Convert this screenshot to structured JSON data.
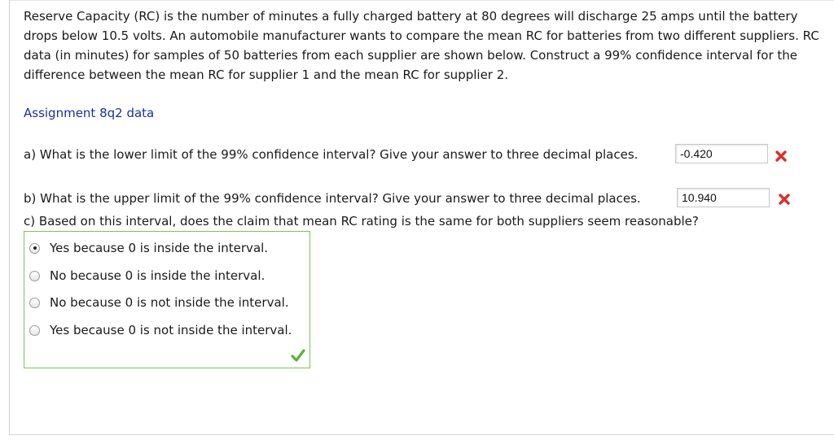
{
  "question": {
    "intro": "Reserve Capacity (RC) is the number of minutes a fully charged battery at 80 degrees will discharge 25 amps until the battery drops below 10.5 volts. An automobile manufacturer wants to compare the mean RC for batteries from two different suppliers. RC data (in minutes) for samples of 50 batteries from each supplier are shown below. Construct a 99% confidence interval for the difference between the mean RC for supplier 1 and the mean RC for supplier 2.",
    "data_link": "Assignment 8q2 data"
  },
  "part_a": {
    "prompt": "a) What is the lower limit of the 99% confidence interval? Give your answer to three decimal places.",
    "answer": "-0.420",
    "status_icon": "incorrect-x-icon"
  },
  "part_b": {
    "prompt": "b) What is the upper limit of the 99% confidence interval? Give your answer to three decimal places.",
    "answer": "10.940",
    "status_icon": "incorrect-x-icon"
  },
  "part_c": {
    "prompt": "c) Based on this interval, does the claim that mean RC rating is the same for both suppliers seem reasonable?",
    "options": [
      {
        "label": "Yes because 0 is inside the interval.",
        "selected": true
      },
      {
        "label": "No because 0 is inside the interval.",
        "selected": false
      },
      {
        "label": "No because 0 is not inside the interval.",
        "selected": false
      },
      {
        "label": "Yes because 0 is not inside the interval.",
        "selected": false
      }
    ],
    "status_icon": "correct-check-icon"
  },
  "colors": {
    "link": "#1a2ea8",
    "incorrect": "#d9302c",
    "correct": "#5cb13a",
    "correct_border": "#7cc35a"
  }
}
